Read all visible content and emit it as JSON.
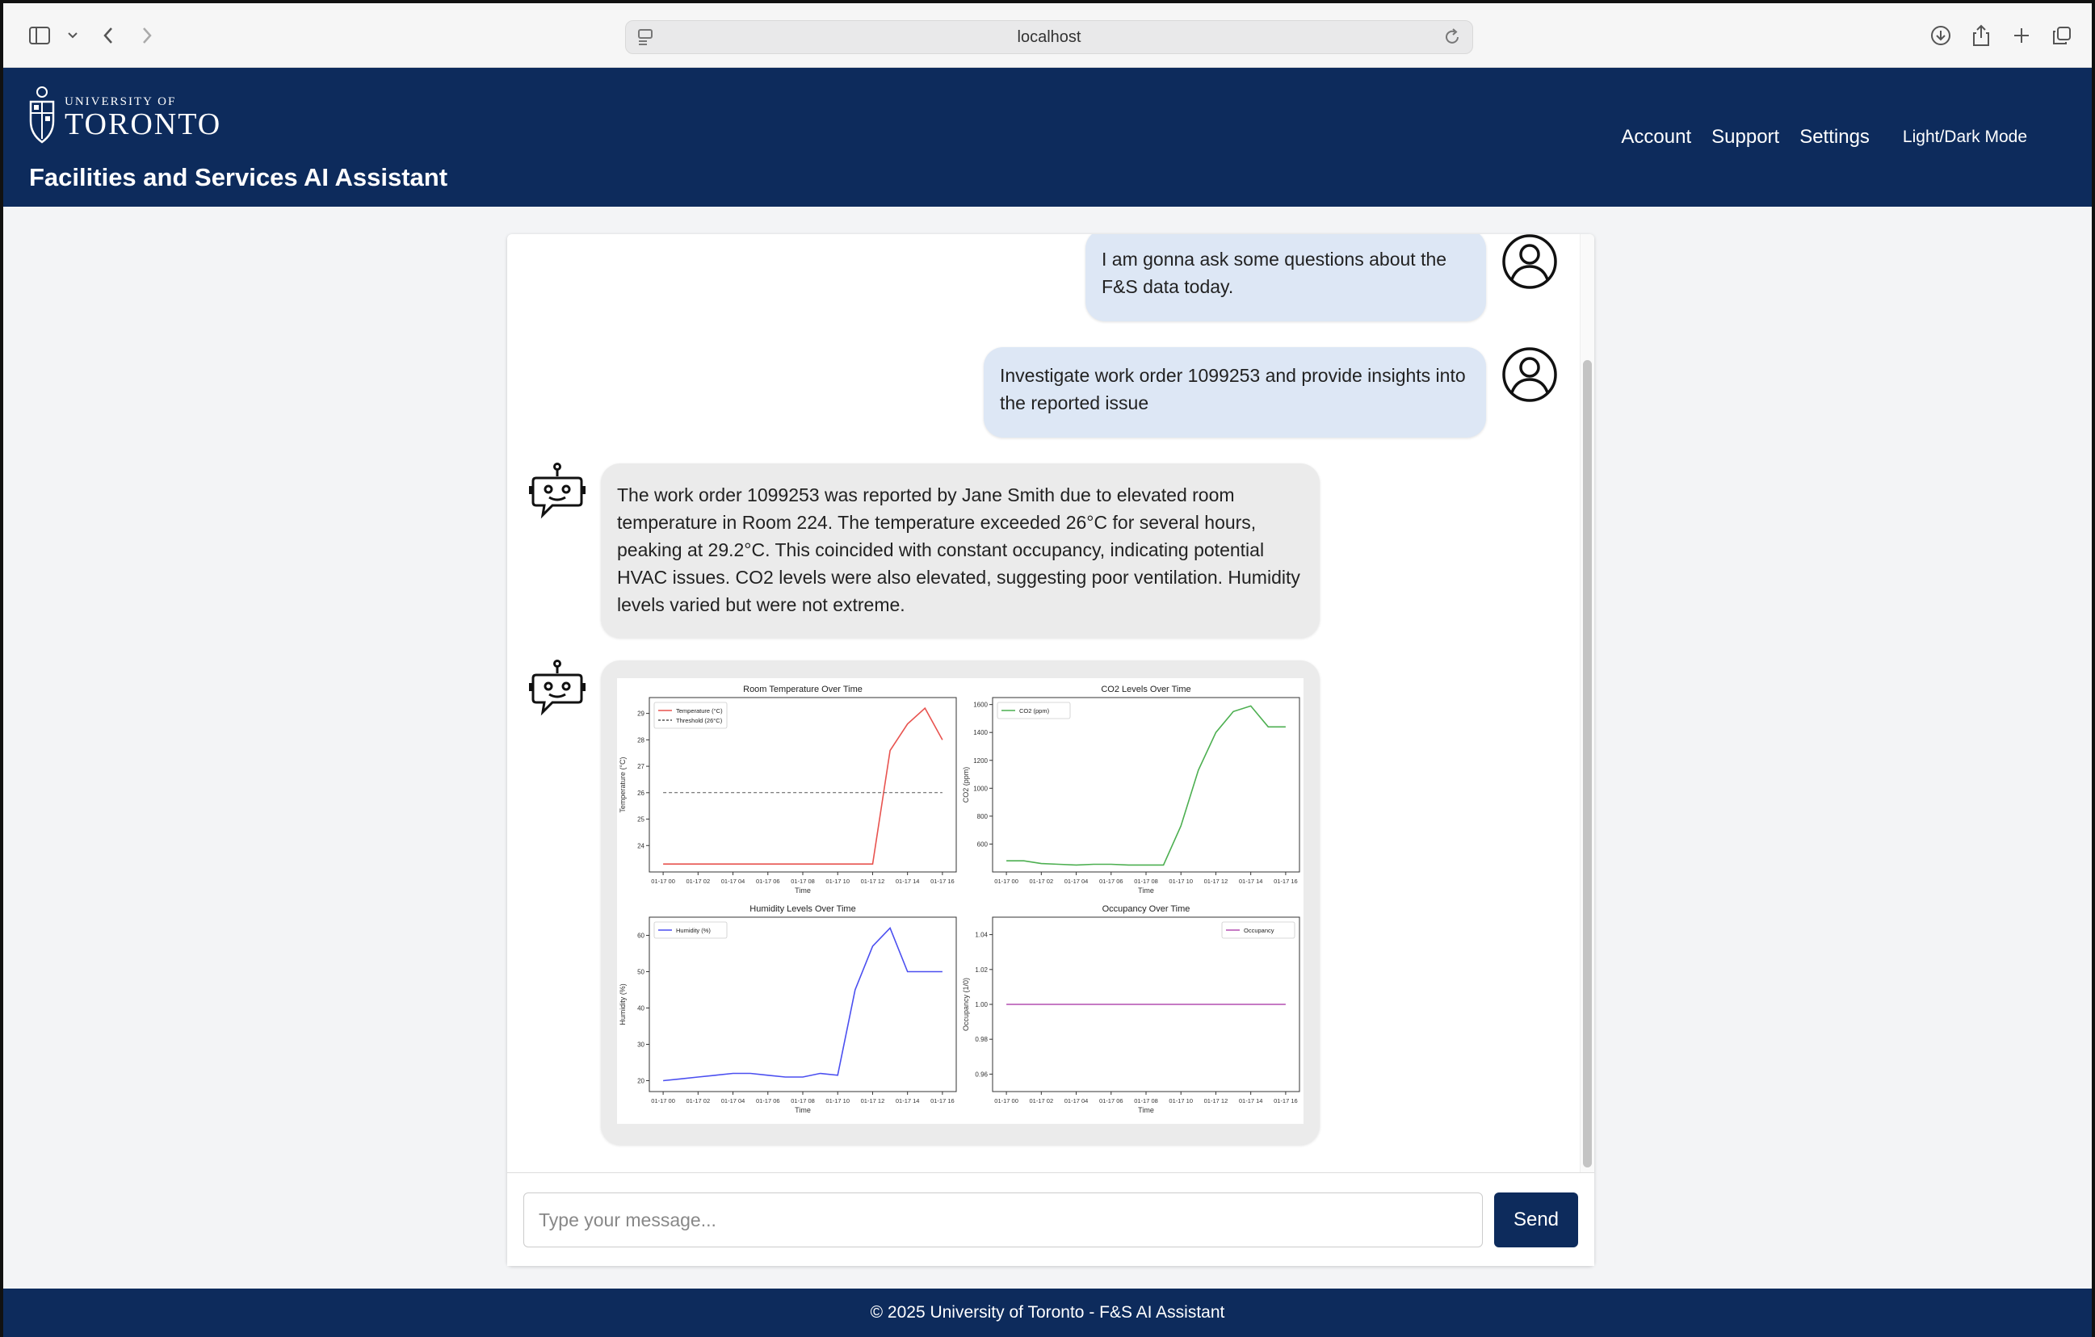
{
  "browser": {
    "address": "localhost"
  },
  "header": {
    "logo_university_of": "UNIVERSITY OF",
    "logo_toronto": "TORONTO",
    "title": "Facilities and Services AI Assistant",
    "nav": [
      "Account",
      "Support",
      "Settings",
      "Light/Dark Mode"
    ]
  },
  "messages": {
    "user1": "I am gonna ask some questions about the F&S data today.",
    "user2": "Investigate work order 1099253 and provide insights into the reported issue",
    "bot1": "The work order 1099253 was reported by Jane Smith due to elevated room temperature in Room 224. The temperature exceeded 26°C for several hours, peaking at 29.2°C. This coincided with constant occupancy, indicating potential HVAC issues. CO2 levels were also elevated, suggesting poor ventilation. Humidity levels varied but were not extreme."
  },
  "input": {
    "placeholder": "Type your message...",
    "send_label": "Send"
  },
  "footer": {
    "text": "© 2025 University of Toronto - F&S AI Assistant"
  },
  "chart_data": [
    {
      "type": "line",
      "title": "Room Temperature Over Time",
      "xlabel": "Time",
      "ylabel": "Temperature (°C)",
      "x": [
        "01-17 00",
        "01-17 01",
        "01-17 02",
        "01-17 03",
        "01-17 04",
        "01-17 05",
        "01-17 06",
        "01-17 07",
        "01-17 08",
        "01-17 09",
        "01-17 10",
        "01-17 11",
        "01-17 12",
        "01-17 13",
        "01-17 14",
        "01-17 15",
        "01-17 16"
      ],
      "xticks": [
        "01-17 00",
        "01-17 02",
        "01-17 04",
        "01-17 06",
        "01-17 08",
        "01-17 10",
        "01-17 12",
        "01-17 14",
        "01-17 16"
      ],
      "ylim": [
        23.0,
        29.6
      ],
      "yticks": [
        24,
        25,
        26,
        27,
        28,
        29
      ],
      "series": [
        {
          "name": "Temperature (°C)",
          "color": "#e8534f",
          "values": [
            23.3,
            23.3,
            23.3,
            23.3,
            23.3,
            23.3,
            23.3,
            23.3,
            23.3,
            23.3,
            23.3,
            23.3,
            23.3,
            27.6,
            28.6,
            29.2,
            28.0
          ]
        },
        {
          "name": "Threshold (26°C)",
          "color": "#555555",
          "dashed": true,
          "values": [
            26,
            26,
            26,
            26,
            26,
            26,
            26,
            26,
            26,
            26,
            26,
            26,
            26,
            26,
            26,
            26,
            26
          ]
        }
      ],
      "legend": "top-left"
    },
    {
      "type": "line",
      "title": "CO2 Levels Over Time",
      "xlabel": "Time",
      "ylabel": "CO2 (ppm)",
      "x": [
        "01-17 00",
        "01-17 01",
        "01-17 02",
        "01-17 03",
        "01-17 04",
        "01-17 05",
        "01-17 06",
        "01-17 07",
        "01-17 08",
        "01-17 09",
        "01-17 10",
        "01-17 11",
        "01-17 12",
        "01-17 13",
        "01-17 14",
        "01-17 15",
        "01-17 16"
      ],
      "xticks": [
        "01-17 00",
        "01-17 02",
        "01-17 04",
        "01-17 06",
        "01-17 08",
        "01-17 10",
        "01-17 12",
        "01-17 14",
        "01-17 16"
      ],
      "ylim": [
        400,
        1650
      ],
      "yticks": [
        600,
        800,
        1000,
        1200,
        1400,
        1600
      ],
      "series": [
        {
          "name": "CO2 (ppm)",
          "color": "#4caf50",
          "values": [
            480,
            480,
            460,
            455,
            450,
            455,
            455,
            450,
            450,
            450,
            730,
            1130,
            1400,
            1550,
            1590,
            1440,
            1440
          ]
        }
      ],
      "legend": "top-left"
    },
    {
      "type": "line",
      "title": "Humidity Levels Over Time",
      "xlabel": "Time",
      "ylabel": "Humidity (%)",
      "x": [
        "01-17 00",
        "01-17 01",
        "01-17 02",
        "01-17 03",
        "01-17 04",
        "01-17 05",
        "01-17 06",
        "01-17 07",
        "01-17 08",
        "01-17 09",
        "01-17 10",
        "01-17 11",
        "01-17 12",
        "01-17 13",
        "01-17 14",
        "01-17 15",
        "01-17 16"
      ],
      "xticks": [
        "01-17 00",
        "01-17 02",
        "01-17 04",
        "01-17 06",
        "01-17 08",
        "01-17 10",
        "01-17 12",
        "01-17 14",
        "01-17 16"
      ],
      "ylim": [
        17,
        65
      ],
      "yticks": [
        20,
        30,
        40,
        50,
        60
      ],
      "series": [
        {
          "name": "Humidity (%)",
          "color": "#4b4ff0",
          "values": [
            20,
            20.5,
            21,
            21.5,
            22,
            22,
            21.5,
            21,
            21,
            22,
            21.5,
            45,
            57,
            62,
            50,
            50,
            50
          ]
        }
      ],
      "legend": "top-left"
    },
    {
      "type": "line",
      "title": "Occupancy Over Time",
      "xlabel": "Time",
      "ylabel": "Occupancy (1/0)",
      "x": [
        "01-17 00",
        "01-17 01",
        "01-17 02",
        "01-17 03",
        "01-17 04",
        "01-17 05",
        "01-17 06",
        "01-17 07",
        "01-17 08",
        "01-17 09",
        "01-17 10",
        "01-17 11",
        "01-17 12",
        "01-17 13",
        "01-17 14",
        "01-17 15",
        "01-17 16"
      ],
      "xticks": [
        "01-17 00",
        "01-17 02",
        "01-17 04",
        "01-17 06",
        "01-17 08",
        "01-17 10",
        "01-17 12",
        "01-17 14",
        "01-17 16"
      ],
      "ylim": [
        0.95,
        1.05
      ],
      "yticks": [
        0.96,
        0.98,
        1.0,
        1.02,
        1.04
      ],
      "series": [
        {
          "name": "Occupancy",
          "color": "#b44fb0",
          "values": [
            1,
            1,
            1,
            1,
            1,
            1,
            1,
            1,
            1,
            1,
            1,
            1,
            1,
            1,
            1,
            1,
            1
          ]
        }
      ],
      "legend": "top-right"
    }
  ]
}
